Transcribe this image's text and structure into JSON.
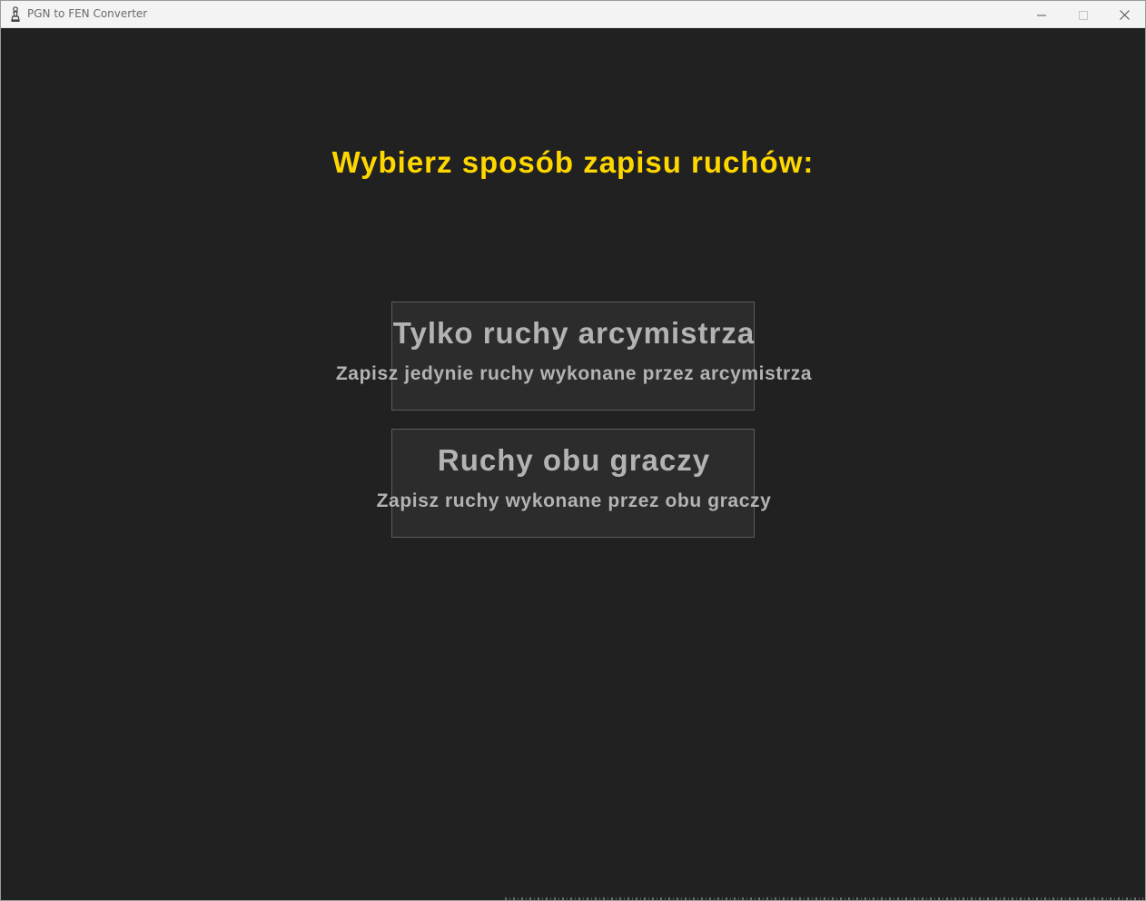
{
  "window": {
    "title": "PGN to FEN Converter",
    "icon": "chess-pawn-icon",
    "controls": [
      "minimize-icon",
      "maximize-icon",
      "close-icon"
    ]
  },
  "main": {
    "heading": "Wybierz sposób zapisu ruchów:",
    "options": [
      {
        "title": "Tylko ruchy arcymistrza",
        "description": "Zapisz jedynie ruchy wykonane przez arcymistrza"
      },
      {
        "title": "Ruchy obu graczy",
        "description": "Zapisz ruchy wykonane przez obu graczy"
      }
    ]
  },
  "colors": {
    "background": "#212121",
    "heading": "#ffd700",
    "option_background": "#2c2c2c",
    "option_border": "#5c5c5c",
    "option_text": "#b3b3b3"
  }
}
